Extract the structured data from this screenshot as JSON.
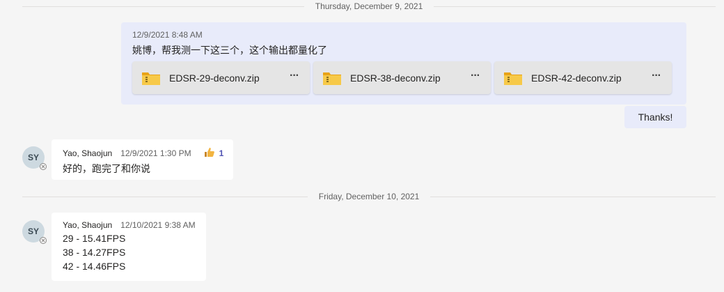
{
  "dividers": {
    "first": "Thursday, December 9, 2021",
    "second": "Friday, December 10, 2021"
  },
  "my_message": {
    "time": "12/9/2021 8:48 AM",
    "text": "姚博，帮我测一下这三个，这个输出都量化了",
    "files": [
      {
        "name": "EDSR-29-deconv.zip",
        "icon": "zip-folder-icon",
        "more": "···"
      },
      {
        "name": "EDSR-38-deconv.zip",
        "icon": "zip-folder-icon",
        "more": "···"
      },
      {
        "name": "EDSR-42-deconv.zip",
        "icon": "zip-folder-icon",
        "more": "···"
      }
    ]
  },
  "thanks_message": {
    "text": "Thanks!"
  },
  "reply1": {
    "avatar": "SY",
    "sender": "Yao, Shaojun",
    "time": "12/9/2021 1:30 PM",
    "reaction": {
      "icon": "thumbs-up-icon",
      "count": "1"
    },
    "text": "好的，跑完了和你说"
  },
  "reply2": {
    "avatar": "SY",
    "sender": "Yao, Shaojun",
    "time": "12/10/2021 9:38 AM",
    "lines": [
      "29 - 15.41FPS",
      "38 - 14.27FPS",
      "42 - 14.46FPS"
    ]
  },
  "colors": {
    "background": "#f5f5f5",
    "my_bubble": "#e8ebfa",
    "other_bubble": "#ffffff",
    "accent": "#4f52b2",
    "folder": "#f7c948"
  }
}
